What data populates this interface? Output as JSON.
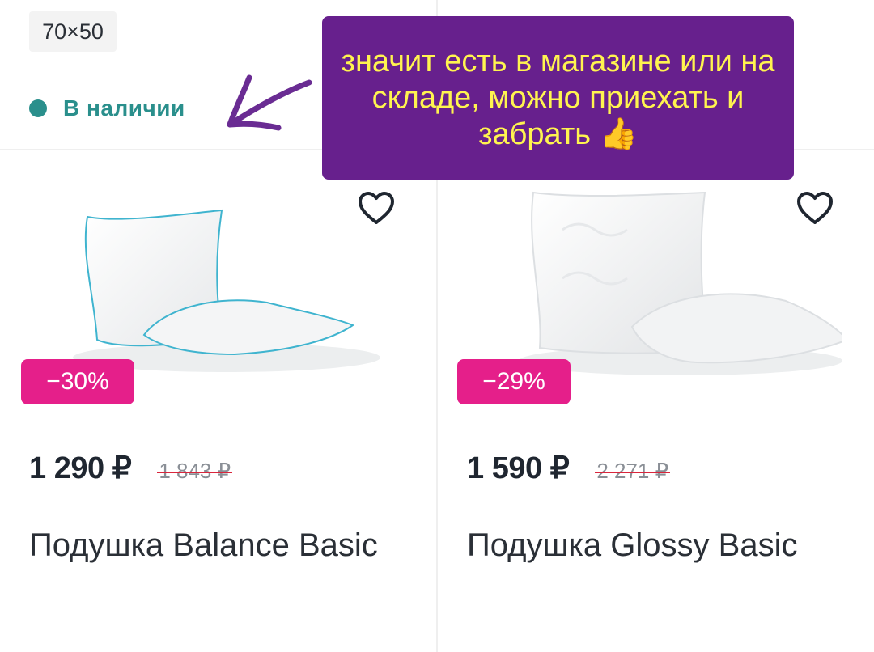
{
  "variant": {
    "size": "70×50"
  },
  "availability": {
    "label": "В наличии",
    "color": "#2a8f8c"
  },
  "annotation": {
    "text": "значит есть в магазине или на складе, можно приехать и забрать 👍",
    "background": "#67208d",
    "text_color": "#fff44f"
  },
  "products": [
    {
      "discount": "−30%",
      "price": "1 290 ₽",
      "old_price": "1 843 ₽",
      "name": "Подушка Balance Basic",
      "icon": "pillow-image"
    },
    {
      "discount": "−29%",
      "price": "1 590 ₽",
      "old_price": "2 271 ₽",
      "name": "Подушка Glossy Basic",
      "icon": "pillow-image"
    }
  ],
  "colors": {
    "badge": "#e51f8a",
    "strike": "#d9263c"
  }
}
